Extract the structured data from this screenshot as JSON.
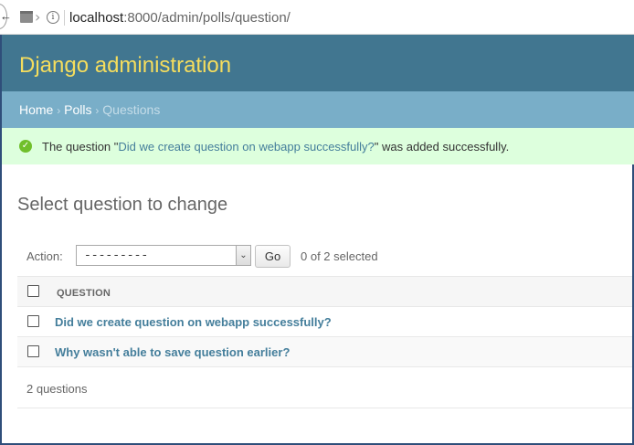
{
  "browser": {
    "url_host": "localhost",
    "url_rest": ":8000/admin/polls/question/",
    "back_glyph": "←",
    "info_glyph": "i",
    "chevron_glyph": "›"
  },
  "header": {
    "site_title": "Django administration"
  },
  "breadcrumbs": {
    "home": "Home",
    "polls": "Polls",
    "current": "Questions",
    "separator": "›"
  },
  "message": {
    "icon_glyph": "✓",
    "prefix": "The question \"",
    "link": "Did we create question on webapp successfully?",
    "suffix": "\" was added successfully."
  },
  "content": {
    "title": "Select question to change"
  },
  "actions": {
    "label": "Action:",
    "selected_value": "---------",
    "go_label": "Go",
    "selected_count": "0 of 2 selected",
    "arrow_glyph": "⌄"
  },
  "table": {
    "header": "QUESTION",
    "rows": [
      "Did we create question on webapp successfully?",
      "Why wasn't able to save question earlier?"
    ]
  },
  "paginator": {
    "text": "2 questions"
  },
  "colors": {
    "header_bg": "#417690",
    "title_yellow": "#f5dd5d",
    "breadcrumb_bg": "#79aec8",
    "success_bg": "#ddffdd",
    "link": "#447e9b"
  }
}
